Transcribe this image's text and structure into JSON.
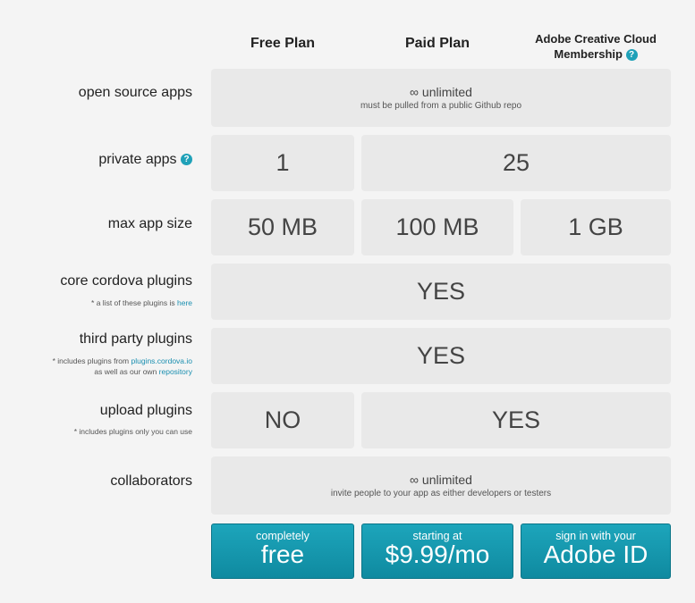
{
  "columns": {
    "free": "Free Plan",
    "paid": "Paid Plan",
    "cc": "Adobe Creative Cloud Membership"
  },
  "rows": {
    "open_source": {
      "label": "open source apps",
      "value": "∞ unlimited",
      "sub": "must be pulled from a public Github repo"
    },
    "private_apps": {
      "label": "private apps",
      "free": "1",
      "paid": "25"
    },
    "max_size": {
      "label": "max app size",
      "free": "50 MB",
      "paid": "100 MB",
      "cc": "1 GB"
    },
    "core_plugins": {
      "label": "core cordova plugins",
      "note_prefix": "* a list of these plugins is",
      "note_link": "here",
      "value": "YES"
    },
    "third_party": {
      "label": "third party plugins",
      "note_prefix": "* includes plugins from",
      "note_link": "plugins.cordova.io",
      "note_mid": "as well as our own",
      "note_link2": "repository",
      "value": "YES"
    },
    "upload": {
      "label": "upload plugins",
      "note": "* includes plugins only you can use",
      "free": "NO",
      "paid": "YES"
    },
    "collaborators": {
      "label": "collaborators",
      "value": "∞ unlimited",
      "sub": "invite people to your app as either developers or testers"
    }
  },
  "buttons": {
    "free": {
      "small": "completely",
      "large": "free"
    },
    "paid": {
      "small": "starting at",
      "large": "$9.99/mo"
    },
    "cc": {
      "small": "sign in with your",
      "large": "Adobe ID"
    }
  },
  "colors": {
    "accent": "#1fa1b8",
    "cell": "#e9e9e9",
    "background": "#f4f4f4"
  }
}
